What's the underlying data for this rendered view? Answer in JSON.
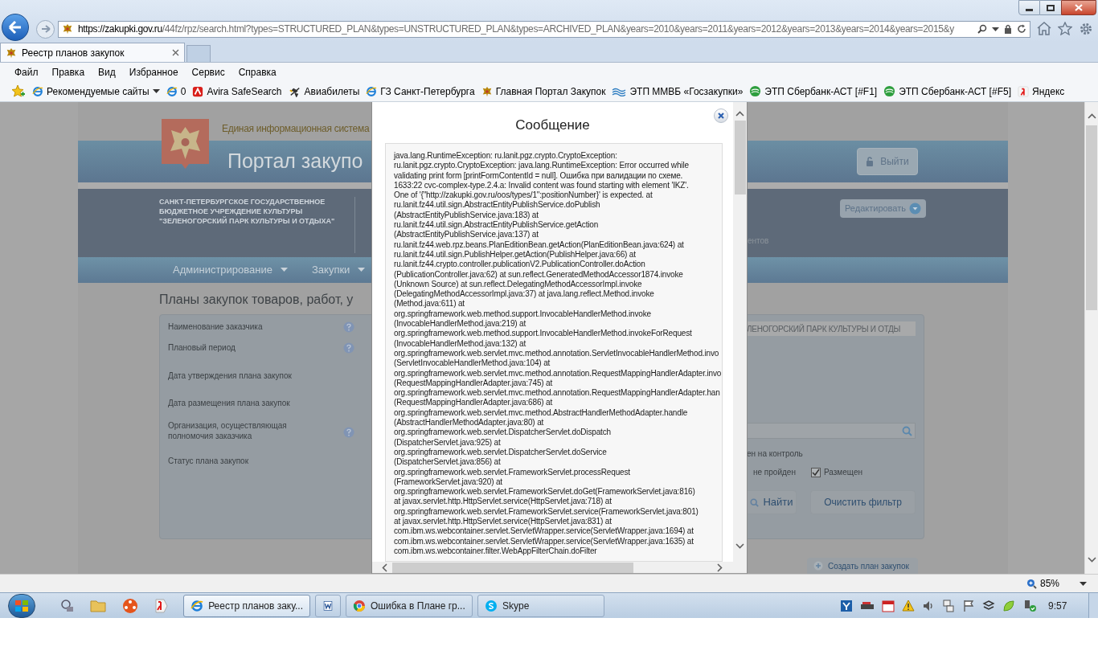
{
  "browser": {
    "address": {
      "host": "https://zakupki.gov.ru",
      "path": "/44fz/rpz/search.html?types=STRUCTURED_PLAN&types=UNSTRUCTURED_PLAN&types=ARCHIVED_PLAN&years=2010&years=2011&years=2012&years=2013&years=2014&years=2015&y"
    },
    "tabs": [
      {
        "title": "Реестр планов закупок",
        "selected": true
      }
    ],
    "menu": [
      "Файл",
      "Правка",
      "Вид",
      "Избранное",
      "Сервис",
      "Справка"
    ],
    "favorites": [
      {
        "label": "Рекомендуемые сайты",
        "kind": "menu"
      },
      {
        "label": "0",
        "kind": "ie"
      },
      {
        "label": "Avira SafeSearch",
        "kind": "avira"
      },
      {
        "label": "Авиабилеты",
        "kind": "plane"
      },
      {
        "label": "ГЗ Санкт-Петербурга",
        "kind": "ie"
      },
      {
        "label": "Главная Портал Закупок",
        "kind": "emblem"
      },
      {
        "label": "ЭТП ММВБ «Госзакупки»",
        "kind": "wave"
      },
      {
        "label": "ЭТП Сбербанк-АСТ [#F1]",
        "kind": "sber"
      },
      {
        "label": "ЭТП Сбербанк-АСТ [#F5]",
        "kind": "sber"
      },
      {
        "label": "Яндекс",
        "kind": "yandex"
      }
    ],
    "zoom": "85%"
  },
  "portal": {
    "system_name": "Единая информационная система",
    "portal_name": "Портал закупо",
    "logout": "Выйти",
    "organization": [
      "САНКТ-ПЕТЕРБУРГСКОЕ ГОСУДАРСТВЕННОЕ",
      "БЮДЖЕТНОЕ УЧРЕЖДЕНИЕ КУЛЬТУРЫ",
      "\"ЗЕЛЕНОГОРСКИЙ ПАРК КУЛЬТУРЫ И ОТДЫХА\""
    ],
    "edit_button": "Редактировать",
    "org_fragment": "ентов",
    "nav": [
      "Администрирование",
      "Закупки"
    ],
    "page_title": "Планы закупок товаров, работ, у",
    "filters": [
      {
        "label": "Наименование заказчика",
        "help": true
      },
      {
        "label": "Плановый период",
        "help": true
      },
      {
        "label": "Дата утверждения плана закупок",
        "help": false
      },
      {
        "label": "Дата размещения плана закупок",
        "help": false
      },
      {
        "label": "Организация, осуществляющая полномочия заказчика",
        "help": true
      },
      {
        "label": "Статус плана закупок",
        "help": false
      }
    ],
    "customer_value": "ЛЕНОГОРСКИЙ ПАРК КУЛЬТУРЫ И ОТДЫ",
    "status_fragment": "ен на контроль",
    "status_fragment_2": "не пройден",
    "placed": {
      "label": "Размещен",
      "checked": true
    },
    "find_button": "Найти",
    "clear_button": "Очистить фильтр",
    "create_button": "Создать план закупок"
  },
  "dialog": {
    "title": "Сообщение",
    "message_lines": [
      "java.lang.RuntimeException: ru.lanit.pgz.crypto.CryptoException:",
      "ru.lanit.pgz.crypto.CryptoException: java.lang.RuntimeException: Error occurred while",
      "validating print form [printFormContentId = null]. Ошибка при валидации по схеме.",
      "1633:22 cvc-complex-type.2.4.a: Invalid content was found starting with element 'IKZ'.",
      "One of '{\"http://zakupki.gov.ru/oos/types/1\":positionNumber}' is expected. at",
      "ru.lanit.fz44.util.sign.AbstractEntityPublishService.doPublish",
      "(AbstractEntityPublishService.java:183) at",
      "ru.lanit.fz44.util.sign.AbstractEntityPublishService.getAction",
      "(AbstractEntityPublishService.java:137) at",
      "ru.lanit.fz44.web.rpz.beans.PlanEditionBean.getAction(PlanEditionBean.java:624) at",
      "ru.lanit.fz44.util.sign.PublishHelper.getAction(PublishHelper.java:66) at",
      "ru.lanit.fz44.crypto.controller.publicationV2.PublicationController.doAction",
      "(PublicationController.java:62) at sun.reflect.GeneratedMethodAccessor1874.invoke",
      "(Unknown Source) at sun.reflect.DelegatingMethodAccessorImpl.invoke",
      "(DelegatingMethodAccessorImpl.java:37) at java.lang.reflect.Method.invoke",
      "(Method.java:611) at",
      "org.springframework.web.method.support.InvocableHandlerMethod.invoke",
      "(InvocableHandlerMethod.java:219) at",
      "org.springframework.web.method.support.InvocableHandlerMethod.invokeForRequest",
      "(InvocableHandlerMethod.java:132) at",
      "org.springframework.web.servlet.mvc.method.annotation.ServletInvocableHandlerMethod.invo",
      "(ServletInvocableHandlerMethod.java:104) at",
      "org.springframework.web.servlet.mvc.method.annotation.RequestMappingHandlerAdapter.invo",
      "(RequestMappingHandlerAdapter.java:745) at",
      "org.springframework.web.servlet.mvc.method.annotation.RequestMappingHandlerAdapter.han",
      "(RequestMappingHandlerAdapter.java:686) at",
      "org.springframework.web.servlet.mvc.method.AbstractHandlerMethodAdapter.handle",
      "(AbstractHandlerMethodAdapter.java:80) at",
      "org.springframework.web.servlet.DispatcherServlet.doDispatch",
      "(DispatcherServlet.java:925) at",
      "org.springframework.web.servlet.DispatcherServlet.doService",
      "(DispatcherServlet.java:856) at",
      "org.springframework.web.servlet.FrameworkServlet.processRequest",
      "(FrameworkServlet.java:920) at",
      "org.springframework.web.servlet.FrameworkServlet.doGet(FrameworkServlet.java:816)",
      "at javax.servlet.http.HttpServlet.service(HttpServlet.java:718) at",
      "org.springframework.web.servlet.FrameworkServlet.service(FrameworkServlet.java:801)",
      "at javax.servlet.http.HttpServlet.service(HttpServlet.java:831) at",
      "com.ibm.ws.webcontainer.servlet.ServletWrapper.service(ServletWrapper.java:1694) at",
      "com.ibm.ws.webcontainer.servlet.ServletWrapper.service(ServletWrapper.java:1635) at",
      "com.ibm.ws.webcontainer.filter.WebAppFilterChain.doFilter"
    ]
  },
  "taskbar": {
    "windows": [
      {
        "title": "Реестр планов заку...",
        "kind": "ie",
        "selected": true
      },
      {
        "kind": "word",
        "selected": false
      },
      {
        "title": "Ошибка в Плане гр...",
        "kind": "chrome",
        "selected": false
      },
      {
        "title": "Skype",
        "kind": "skype",
        "selected": false
      }
    ],
    "clock": "9:57"
  }
}
